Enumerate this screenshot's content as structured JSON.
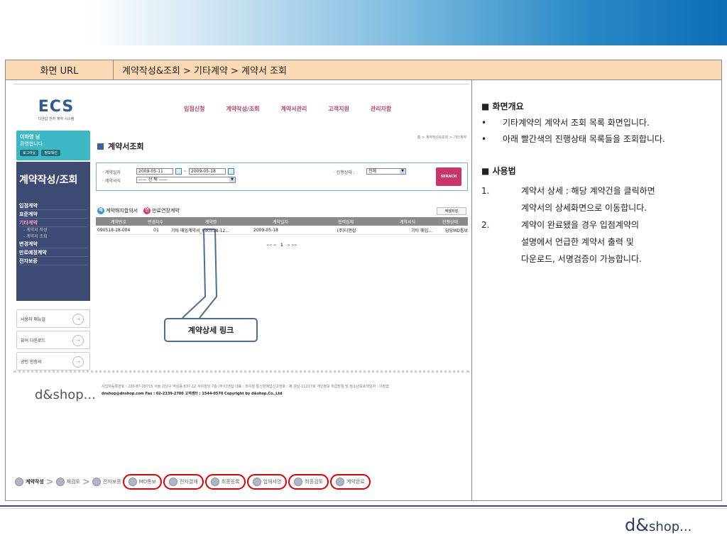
{
  "header": {
    "label": "화면 URL",
    "path": "계약작성&조회 > 기타계약 > 계약서 조회"
  },
  "screen": {
    "logo": {
      "main": "ECS",
      "sub": "디앤샵 전자 계약 시스템"
    },
    "gnb": [
      "입점신청",
      "계약작성/조회",
      "계약서관리",
      "고객지원",
      "관리자함"
    ],
    "user": {
      "name": "이하영 님",
      "greet": "환영합니다.",
      "logout": "로그아웃",
      "info": "정보확인"
    },
    "side_title": "계약작성/조회",
    "menu": [
      {
        "label": "입점계약",
        "cls": ""
      },
      {
        "label": "표준계약",
        "cls": ""
      },
      {
        "label": "기타계약",
        "cls": "active"
      },
      {
        "label": "- 계약서 작성",
        "cls": "sub"
      },
      {
        "label": "- 계약서 조회",
        "cls": "sub"
      },
      {
        "label": "변경계약",
        "cls": ""
      },
      {
        "label": "만료예정계약",
        "cls": ""
      },
      {
        "label": "전자보증",
        "cls": ""
      }
    ],
    "links": [
      "사용자 매뉴얼",
      "뷰어 다운로드",
      "공인 인증서"
    ],
    "page_title": "계약서조회",
    "crumb": "홈 > 계약작성&조회 > 기타계약",
    "search": {
      "date_label": "· 계약일자",
      "from": "2009-05-11",
      "to": "2009-05-18",
      "tilde": "~",
      "form_label": "· 계약서식",
      "form_value": "—— 선 택 ——",
      "status_label": "· 진행상태 :",
      "status_value": "전체",
      "button": "SERACH"
    },
    "legend": {
      "a": "계약해지합의서",
      "b": "만료연장계약",
      "a_mark": "해",
      "b_mark": "연"
    },
    "excel": "엑셀저장",
    "table": {
      "headers": [
        "계약번호",
        "변경차수",
        "계약명",
        "계약일자",
        "협력업체",
        "계약서식",
        "진행상태"
      ],
      "rows": [
        [
          "090518-18-004",
          "01",
          "기타 매입계약서_090518-12...",
          "2009-05-18",
          "(주)디앤샵",
          "기타 매입...",
          "담당MD통보"
        ]
      ]
    },
    "pager": {
      "prev": "<<  <",
      "page": "1",
      "next": ">  >>"
    },
    "callout": "계약상세 링크",
    "footer": {
      "logo": "d&shop...",
      "line1": "사업자등록번호 : 220-87-28715  서울 강남구 역삼동 837-12 서우빌딩 7층 (주)디앤샵  대표 : 최우정 통신판매업신고번호 : 제 강남-11217호 개인정보 취급방침 및 청소년보호책임자 : 이정엽",
      "line2": "dnshop@dnshop.com Fax : 02-2139-2700 고객센터 : 1544-0570 Copyright by d&shop.Co.,Ltd"
    },
    "flow": [
      {
        "label": "계약작성",
        "bold": true,
        "ring": false
      },
      {
        "label": "재검토",
        "bold": false,
        "ring": false
      },
      {
        "label": "전자보증",
        "bold": false,
        "ring": false
      },
      {
        "label": "MD통보",
        "bold": false,
        "ring": true
      },
      {
        "label": "전자결재",
        "bold": false,
        "ring": true
      },
      {
        "label": "최종등록",
        "bold": false,
        "ring": true
      },
      {
        "label": "업체서명",
        "bold": false,
        "ring": true
      },
      {
        "label": "최종검토",
        "bold": false,
        "ring": true
      },
      {
        "label": "계약완료",
        "bold": false,
        "ring": true
      }
    ]
  },
  "desc": {
    "overview_title": "■ 화면개요",
    "overview": [
      "기타계약의 계약서 조회 목록 화면입니다.",
      "아래 빨간색의 진행상태 목록들을 조회합니다."
    ],
    "usage_title": "■ 사용법",
    "usage1_no": "1.",
    "usage1_a": "계약서 상세 : 해당 계약건을 클릭하면",
    "usage1_b": "계약서의 상세화면으로 이동합니다.",
    "usage2_no": "2.",
    "usage2_a": "계약이 완료됐을 경우 입점계약의",
    "usage2_b": "설명에서 언급한 계약서 출력 및",
    "usage2_c": "다운로드, 서명검증이 가능합니다."
  },
  "brand": {
    "main": "d&",
    "rest": "shop..."
  }
}
